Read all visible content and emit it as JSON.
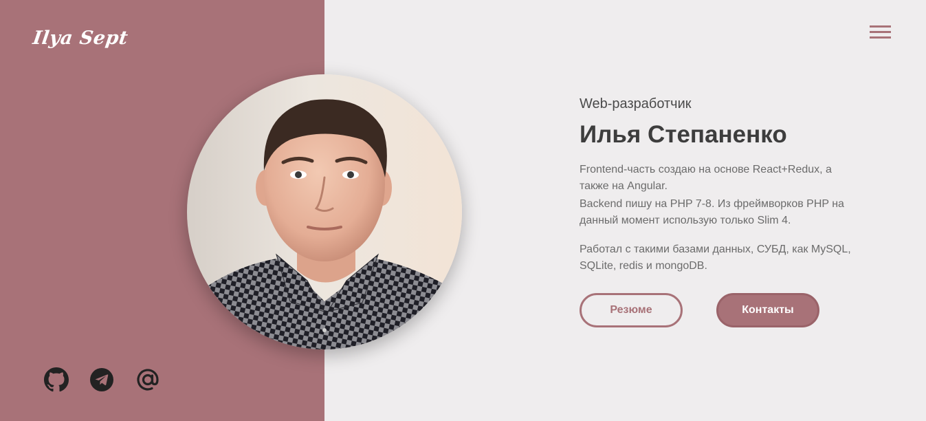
{
  "header": {
    "logo_text": "Ilya Sept",
    "menu_icon": "hamburger-menu-icon"
  },
  "hero": {
    "subtitle": "Web-разработчик",
    "name": "Илья Степаненко",
    "paragraphs": [
      "Frontend-часть создаю на основе React+Redux, а также на Angular.",
      "Backend пишу на PHP 7-8. Из фреймворков PHP на данный момент использую только Slim 4.",
      "Работал с такими базами данных, СУБД, как MySQL, SQLite, redis и mongoDB."
    ],
    "buttons": {
      "resume": "Резюме",
      "contacts": "Контакты"
    }
  },
  "social": [
    {
      "icon": "github-icon"
    },
    {
      "icon": "telegram-icon"
    },
    {
      "icon": "email-at-icon"
    }
  ],
  "colors": {
    "accent": "#a87278",
    "background": "#efedee",
    "heading": "#3d3d3d",
    "text": "#6b6b6b",
    "icon": "#222222"
  }
}
